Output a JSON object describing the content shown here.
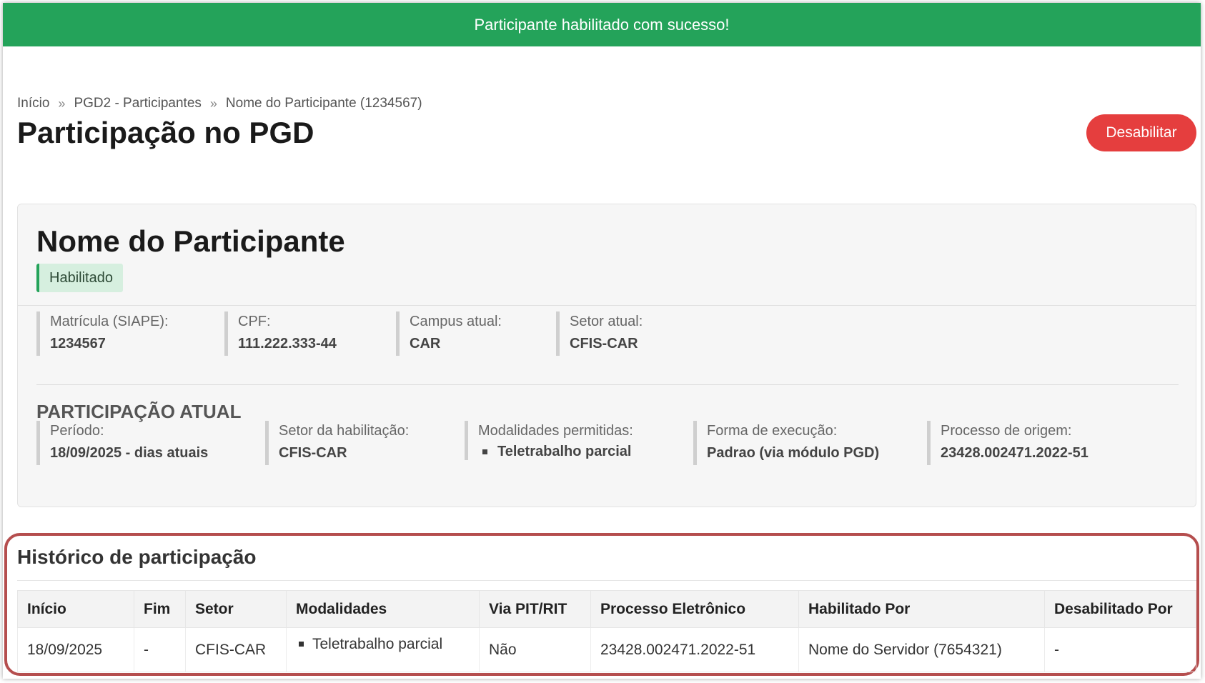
{
  "alert": {
    "message": "Participante habilitado com sucesso!",
    "color": "#24a35a"
  },
  "breadcrumb": [
    {
      "label": "Início"
    },
    {
      "label": "PGD2 - Participantes"
    },
    {
      "label": "Nome do Participante (1234567)"
    }
  ],
  "breadcrumb_separator": "»",
  "page": {
    "title": "Participação no PGD"
  },
  "actions": {
    "disable_label": "Desabilitar",
    "disable_color": "#e53e3e"
  },
  "participant": {
    "name": "Nome do Participante",
    "status": "Habilitado",
    "fields": {
      "matricula": {
        "label": "Matrícula (SIAPE):",
        "value": "1234567"
      },
      "cpf": {
        "label": "CPF:",
        "value": "111.222.333-44"
      },
      "campus": {
        "label": "Campus atual:",
        "value": "CAR"
      },
      "setor": {
        "label": "Setor atual:",
        "value": "CFIS-CAR"
      }
    }
  },
  "current": {
    "title": "PARTICIPAÇÃO ATUAL",
    "periodo": {
      "label": "Período:",
      "value": "18/09/2025 - dias atuais"
    },
    "setor_habilitacao": {
      "label": "Setor da habilitação:",
      "value": "CFIS-CAR"
    },
    "modalidades": {
      "label": "Modalidades permitidas:",
      "items": [
        "Teletrabalho parcial"
      ]
    },
    "forma_execucao": {
      "label": "Forma de execução:",
      "value": "Padrao (via módulo PGD)"
    },
    "processo_origem": {
      "label": "Processo de origem:",
      "value": "23428.002471.2022-51"
    }
  },
  "history": {
    "title": "Histórico de participação",
    "columns": [
      "Início",
      "Fim",
      "Setor",
      "Modalidades",
      "Via PIT/RIT",
      "Processo Eletrônico",
      "Habilitado Por",
      "Desabilitado Por"
    ],
    "rows": [
      {
        "inicio": "18/09/2025",
        "fim": "-",
        "setor": "CFIS-CAR",
        "modalidades": [
          "Teletrabalho parcial"
        ],
        "via_pit_rit": "Não",
        "processo": "23428.002471.2022-51",
        "habilitado_por": "Nome do Servidor (7654321)",
        "desabilitado_por": "-"
      }
    ]
  }
}
